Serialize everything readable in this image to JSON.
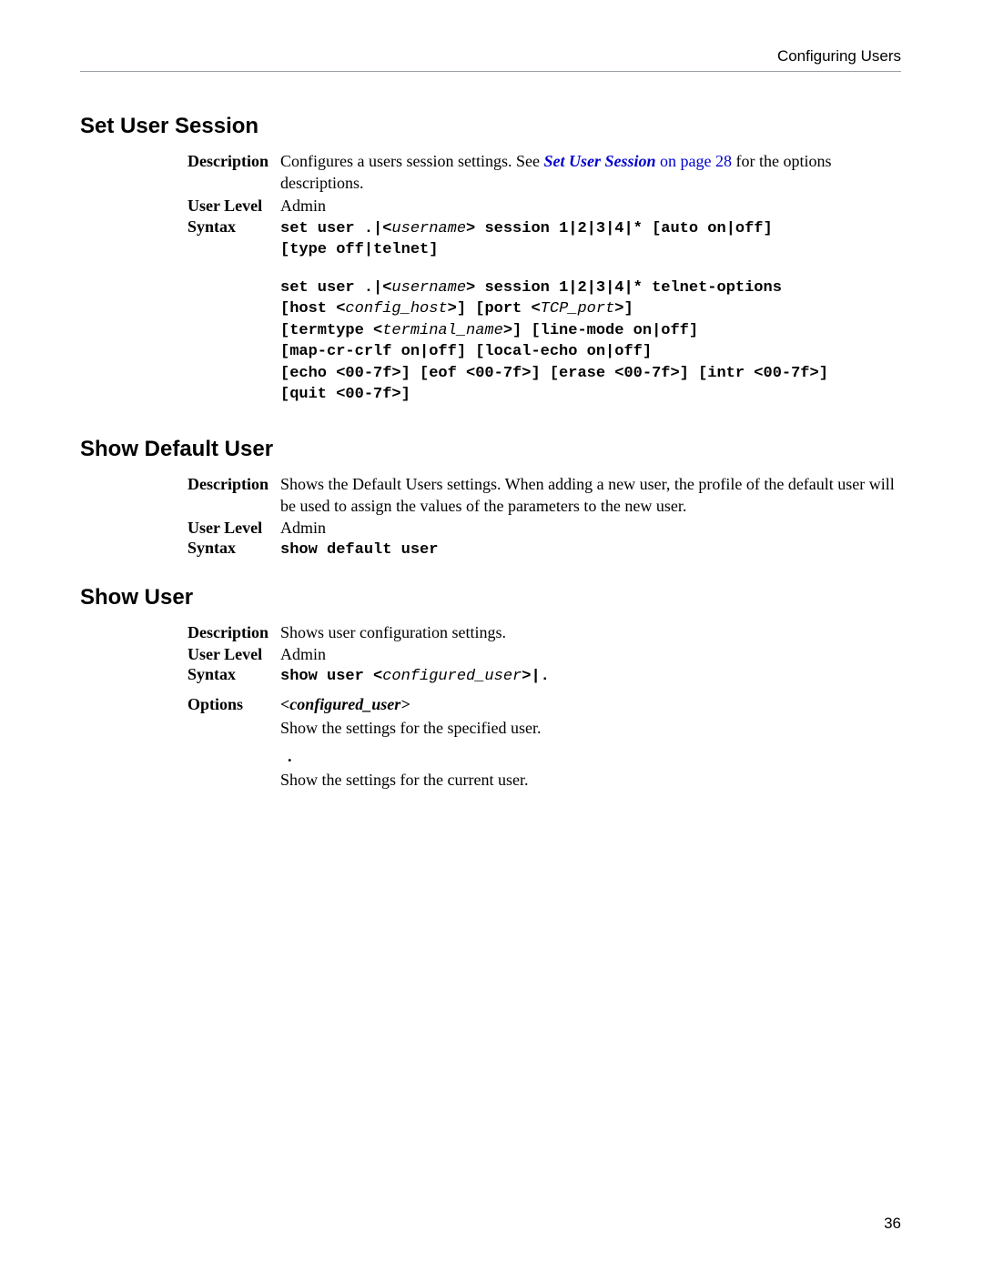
{
  "header": {
    "title": "Configuring Users"
  },
  "sections": {
    "set_user_session": {
      "heading": "Set User Session",
      "description_pre": "Configures a users session settings. See ",
      "link_text": "Set User Session",
      "link_page_text": " on page 28",
      "description_post": " for the options descriptions.",
      "user_level_label": "User Level",
      "user_level": "Admin",
      "syntax_label": "Syntax",
      "syntax1_a": "set user .|<",
      "syntax1_b": "username",
      "syntax1_c": "> session 1|2|3|4|* [auto on|off]",
      "syntax1_line2": "[type off|telnet]",
      "syntax2_a": "set user .|<",
      "syntax2_b": "username",
      "syntax2_c": "> session 1|2|3|4|* telnet-options",
      "syntax2_l2a": "[host <",
      "syntax2_l2b": "config_host",
      "syntax2_l2c": ">] [port <",
      "syntax2_l2d": "TCP_port",
      "syntax2_l2e": ">]",
      "syntax2_l3a": "[termtype <",
      "syntax2_l3b": "terminal_name",
      "syntax2_l3c": ">] [line-mode on|off]",
      "syntax2_l4": "[map-cr-crlf on|off] [local-echo on|off]",
      "syntax2_l5": "[echo <00-7f>] [eof <00-7f>] [erase <00-7f>] [intr <00-7f>]",
      "syntax2_l6": "[quit <00-7f>]"
    },
    "show_default_user": {
      "heading": "Show Default User",
      "description": "Shows the Default Users settings. When adding a new user, the profile of the default user will be used to assign the values of the parameters to the new user.",
      "user_level_label": "User Level",
      "user_level": "Admin",
      "syntax_label": "Syntax",
      "syntax": "show default user"
    },
    "show_user": {
      "heading": "Show User",
      "description_label": "Description",
      "description": "Shows user configuration settings.",
      "user_level_label": "User Level",
      "user_level": "Admin",
      "syntax_label": "Syntax",
      "syntax_a": "show user <",
      "syntax_b": "configured_user",
      "syntax_c": ">|.",
      "options_label": "Options",
      "opt1_term": "<configured_user>",
      "opt1_desc": "Show the settings for the specified user.",
      "opt2_term": ".",
      "opt2_desc": "Show the settings for the current user."
    }
  },
  "labels": {
    "description": "Description"
  },
  "page_number": "36"
}
